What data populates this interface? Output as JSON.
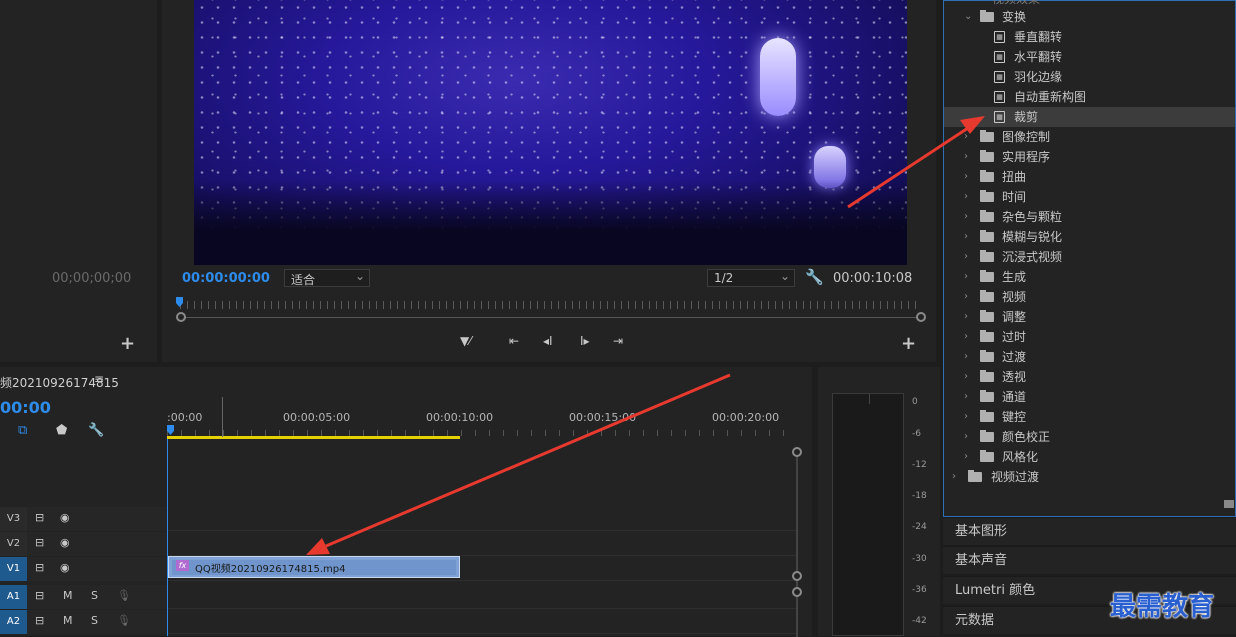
{
  "source_monitor": {
    "timecode": "00;00;00;00",
    "add_label": "+"
  },
  "program_monitor": {
    "timecode_current": "00:00:00:00",
    "fit_select": "适合",
    "resolution_select": "1/2",
    "wrench_icon": "wrench-icon",
    "timecode_duration": "00:00:10:08",
    "add_label": "+",
    "transport": {
      "add_marker": "add-marker-icon",
      "step_back_edit": "⇤",
      "step_back": "◂I",
      "step_forward": "I▸",
      "step_forward_edit": "⇥"
    }
  },
  "timeline": {
    "sequence_name": "频20210926174815",
    "menu_icon": "≡",
    "timecode": "00:00",
    "ruler_labels": [
      ":00:00",
      "00:00:05:00",
      "00:00:10:00",
      "00:00:15:00",
      "00:00:20:00"
    ],
    "tracks": [
      {
        "label": "V3",
        "lock": "⊟",
        "eye": "👁"
      },
      {
        "label": "V2",
        "lock": "⊟",
        "eye": "👁"
      },
      {
        "label": "V1",
        "lock": "⊟",
        "eye": "👁"
      },
      {
        "label": "A1",
        "lock": "⊟",
        "m": "M",
        "s": "S"
      },
      {
        "label": "A2",
        "lock": "⊟",
        "m": "M",
        "s": "S"
      }
    ],
    "clip": {
      "fx": "fx",
      "name": "QQ视频20210926174815.mp4"
    }
  },
  "audio_meter": {
    "db_labels": [
      "0",
      "-6",
      "-12",
      "-18",
      "-24",
      "-30",
      "-36",
      "-42"
    ]
  },
  "effects_panel": {
    "partial_top": "视频效果",
    "items": [
      {
        "type": "folder",
        "open": true,
        "label": "变换"
      },
      {
        "type": "effect",
        "label": "垂直翻转"
      },
      {
        "type": "effect",
        "label": "水平翻转"
      },
      {
        "type": "effect",
        "label": "羽化边缘"
      },
      {
        "type": "effect",
        "label": "自动重新构图"
      },
      {
        "type": "effect",
        "label": "裁剪",
        "selected": true
      },
      {
        "type": "folder",
        "label": "图像控制"
      },
      {
        "type": "folder",
        "label": "实用程序"
      },
      {
        "type": "folder",
        "label": "扭曲"
      },
      {
        "type": "folder",
        "label": "时间"
      },
      {
        "type": "folder",
        "label": "杂色与颗粒"
      },
      {
        "type": "folder",
        "label": "模糊与锐化"
      },
      {
        "type": "folder",
        "label": "沉浸式视频"
      },
      {
        "type": "folder",
        "label": "生成"
      },
      {
        "type": "folder",
        "label": "视频"
      },
      {
        "type": "folder",
        "label": "调整"
      },
      {
        "type": "folder",
        "label": "过时"
      },
      {
        "type": "folder",
        "label": "过渡"
      },
      {
        "type": "folder",
        "label": "透视"
      },
      {
        "type": "folder",
        "label": "通道"
      },
      {
        "type": "folder",
        "label": "键控"
      },
      {
        "type": "folder",
        "label": "颜色校正"
      },
      {
        "type": "folder",
        "label": "风格化"
      },
      {
        "type": "folder-top",
        "label": "视频过渡"
      }
    ]
  },
  "side_panels": [
    "基本图形",
    "基本声音",
    "Lumetri 颜色",
    "元数据"
  ],
  "watermark": "最需教育",
  "colors": {
    "accent": "#2d8ceb",
    "arrow": "#e8392f",
    "clip": "#7fa2d6",
    "workbar": "#e5d000"
  }
}
